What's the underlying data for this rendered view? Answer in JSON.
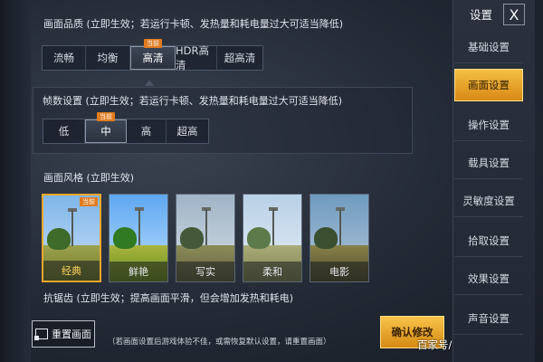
{
  "quality": {
    "title": "画面品质 (立即生效；若运行卡顿、发热量和耗电量过大可适当降低)",
    "badge": "当前",
    "options": [
      "流畅",
      "均衡",
      "高清",
      "HDR高清",
      "超高清"
    ],
    "selected": "高清"
  },
  "fps": {
    "title": "帧数设置 (立即生效；若运行卡顿、发热量和耗电量过大可适当降低)",
    "badge": "当前",
    "options": [
      "低",
      "中",
      "高",
      "超高"
    ],
    "selected": "中"
  },
  "style": {
    "title": "画面风格 (立即生效)",
    "badge": "当前",
    "cards": [
      {
        "label": "经典"
      },
      {
        "label": "鲜艳"
      },
      {
        "label": "写实"
      },
      {
        "label": "柔和"
      },
      {
        "label": "电影"
      }
    ],
    "selected": "经典"
  },
  "antialias": {
    "title": "抗锯齿 (立即生效；提高画面平滑，但会增加发热和耗电)"
  },
  "bottom": {
    "reset_label": "重置画面",
    "note": "（若画面设置后游戏体验不佳，或需恢复默认设置，请重置画面）",
    "confirm_label": "确认修改",
    "watermark": "百家号/电竞达小摩"
  },
  "sidebar": {
    "title": "设置",
    "close": "X",
    "items": [
      "基础设置",
      "画面设置",
      "操作设置",
      "载具设置",
      "灵敏度设置",
      "拾取设置",
      "效果设置",
      "声音设置"
    ],
    "active": "画面设置"
  },
  "colors": {
    "accent": "#f0a62c",
    "badge": "#e07b1e"
  }
}
